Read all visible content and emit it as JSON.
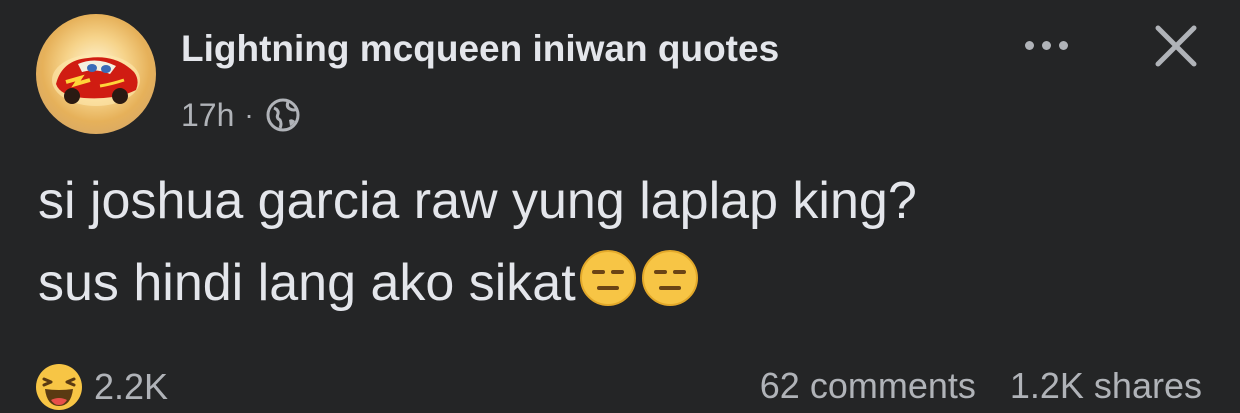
{
  "post": {
    "author": "Lightning mcqueen iniwan quotes",
    "timestamp": "17h",
    "separator": "·",
    "audience_icon": "globe-icon",
    "text_line1": "si joshua garcia raw yung laplap king?",
    "text_line2": "sus hindi lang ako sikat",
    "trailing_emojis": [
      "expressionless-face-emoji",
      "expressionless-face-emoji"
    ]
  },
  "header_actions": {
    "more_icon": "more-horizontal-icon",
    "close_icon": "close-icon"
  },
  "engagement": {
    "reaction_icon": "haha-reaction-icon",
    "reaction_count": "2.2K",
    "comments": "62 comments",
    "shares": "1.2K shares"
  },
  "colors": {
    "background": "#242526",
    "primary_text": "#e4e6eb",
    "secondary_text": "#b0b3b8",
    "emoji_yellow": "#f7c545"
  }
}
